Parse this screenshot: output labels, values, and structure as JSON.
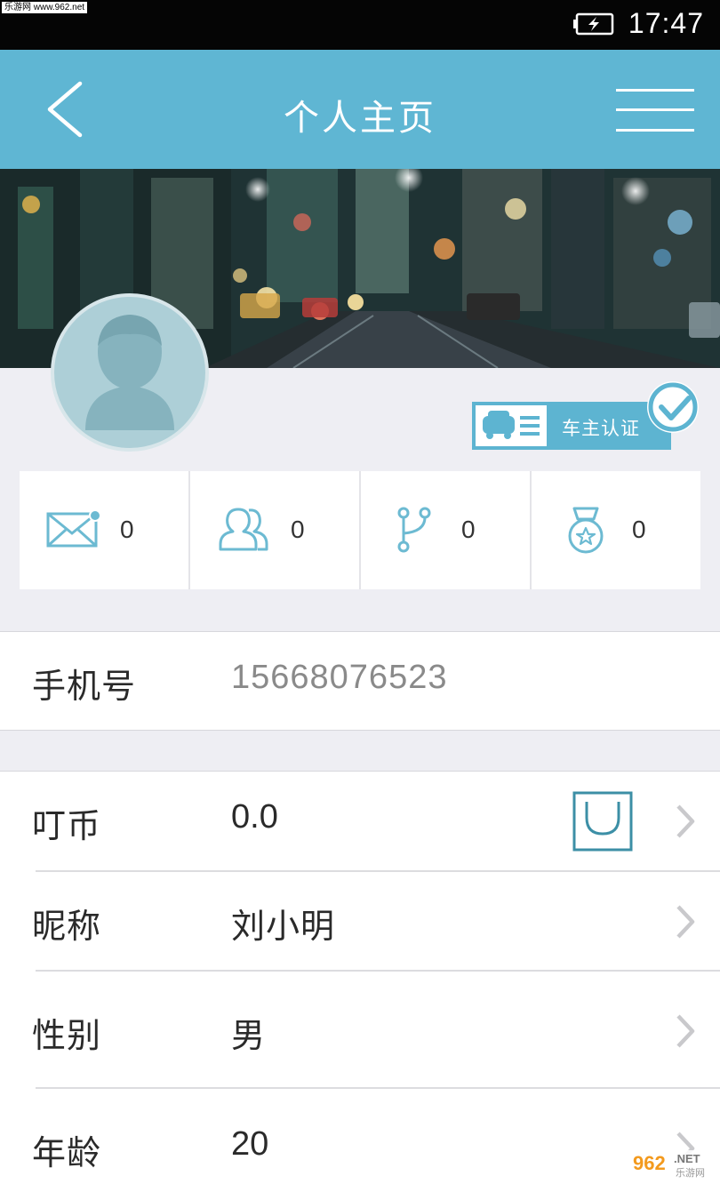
{
  "status_bar": {
    "time": "17:47",
    "watermark": "乐游网 www.962.net"
  },
  "header": {
    "title": "个人主页"
  },
  "profile": {
    "verify_label": "车主认证"
  },
  "stats": [
    {
      "icon": "mail-icon",
      "value": "0"
    },
    {
      "icon": "users-icon",
      "value": "0"
    },
    {
      "icon": "branch-icon",
      "value": "0"
    },
    {
      "icon": "medal-icon",
      "value": "0"
    }
  ],
  "phone": {
    "label": "手机号",
    "value": "15668076523"
  },
  "rows": {
    "coins": {
      "label": "叮币",
      "value": "0.0"
    },
    "nickname": {
      "label": "昵称",
      "value": "刘小明"
    },
    "gender": {
      "label": "性别",
      "value": "男"
    },
    "age": {
      "label": "年龄",
      "value": "20"
    }
  },
  "watermark_bottom": {
    "brand": "962",
    "site": ".NET",
    "name": "乐游网"
  },
  "colors": {
    "accent": "#5fb6d3",
    "icon": "#6cbad2",
    "badge": "#5db4d1"
  }
}
